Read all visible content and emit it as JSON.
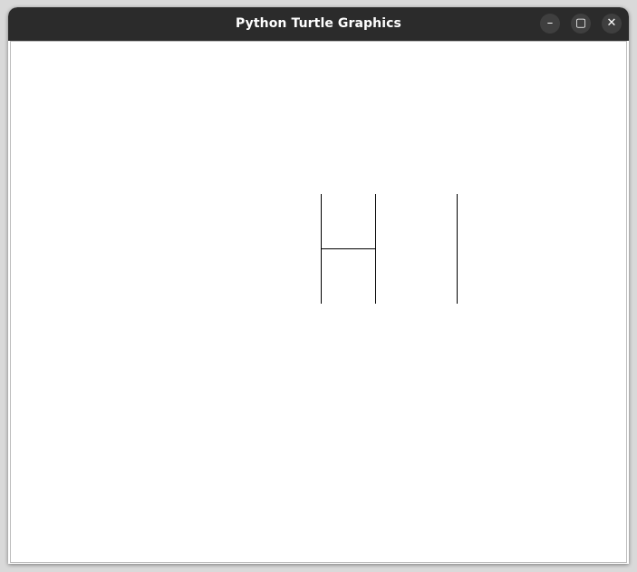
{
  "window": {
    "title": "Python Turtle Graphics"
  },
  "controls": {
    "minimize_icon": "minimize-icon",
    "maximize_icon": "maximize-icon",
    "close_icon": "close-icon",
    "minimize_glyph": "–",
    "maximize_glyph": "▢",
    "close_glyph": "✕"
  },
  "drawing": {
    "pen_color": "#000000",
    "background_color": "#ffffff"
  }
}
